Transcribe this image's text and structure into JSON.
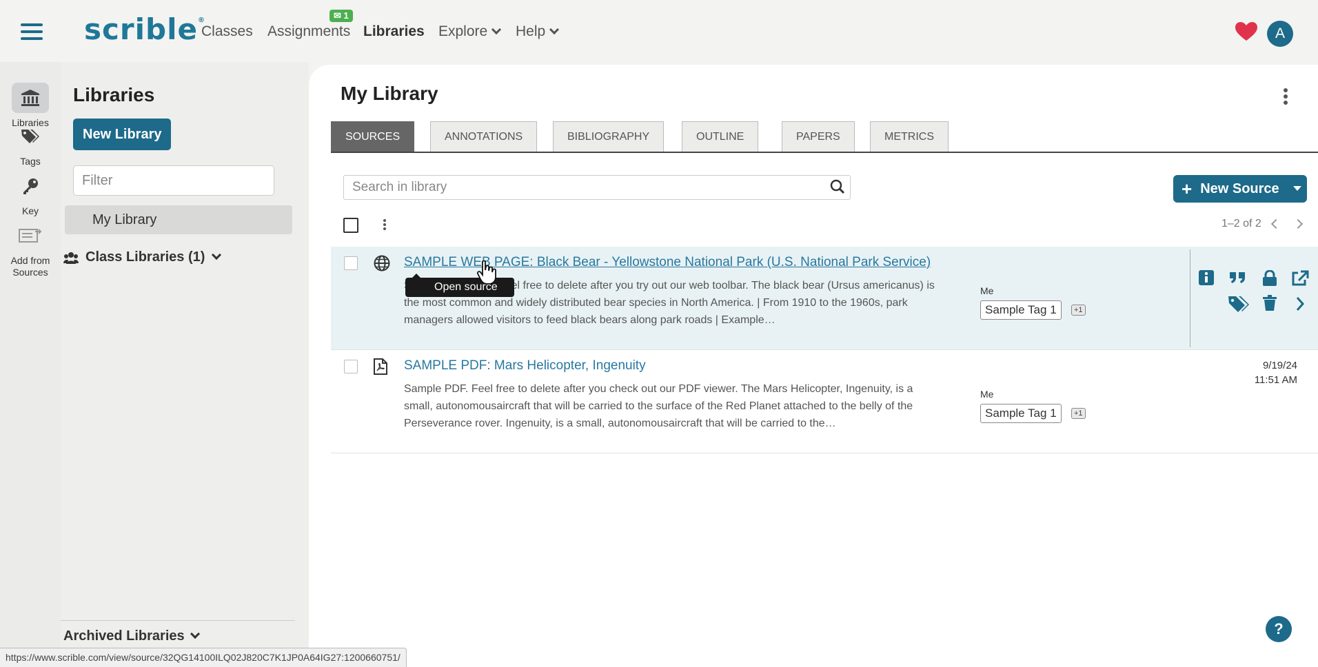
{
  "topnav": {
    "logo": "scrible",
    "logo_mark": "®",
    "links": [
      "Classes",
      "Assignments",
      "Libraries",
      "Explore",
      "Help"
    ],
    "assignments_badge": "1",
    "avatar_letter": "A"
  },
  "rail": {
    "items": [
      {
        "label": "Libraries",
        "icon": "bank-icon"
      },
      {
        "label": "Tags",
        "icon": "tags-icon"
      },
      {
        "label": "Key",
        "icon": "key-icon"
      },
      {
        "label": "Add from Sources",
        "icon": "add-sources-icon"
      }
    ]
  },
  "libraries": {
    "title": "Libraries",
    "new_library_label": "New Library",
    "filter_placeholder": "Filter",
    "my_library": "My Library",
    "class_libraries": "Class Libraries (1)",
    "archived": "Archived Libraries"
  },
  "main": {
    "title": "My Library",
    "tabs": [
      "SOURCES",
      "ANNOTATIONS",
      "BIBLIOGRAPHY",
      "OUTLINE",
      "PAPERS",
      "METRICS"
    ],
    "active_tab": "SOURCES",
    "search_placeholder": "Search in library",
    "new_source_label": "New Source",
    "pager": "1–2 of 2"
  },
  "sources": [
    {
      "type": "web",
      "title": "SAMPLE WEB PAGE: Black Bear - Yellowstone National Park (U.S. National Park Service)",
      "desc": "Sample web page. Feel free to delete after you try out our web toolbar. The black bear (Ursus americanus) is the most common and widely distributed bear species in North America. | From 1910 to the 1960s, park managers allowed visitors to feed black bears along park roads | Example…",
      "owner": "Me",
      "tag": "Sample Tag 1",
      "more_tags": "+1",
      "date": "",
      "time": ""
    },
    {
      "type": "pdf",
      "title": "SAMPLE PDF: Mars Helicopter, Ingenuity",
      "desc": "Sample PDF. Feel free to delete after you check out our PDF viewer. The Mars Helicopter, Ingenuity, is a small, autonomousaircraft that will be carried to the surface of the Red Planet attached to the belly of the Perseverance rover. Ingenuity, is a small, autonomousaircraft that will be carried to the…",
      "owner": "Me",
      "tag": "Sample Tag 1",
      "more_tags": "+1",
      "date": "9/19/24",
      "time": "11:51 AM"
    }
  ],
  "tooltip": "Open source",
  "help_label": "?",
  "status_url": "https://www.scrible.com/view/source/32QG14100ILQ02J820C7K1JP0A64IG27:1200660751/",
  "colors": {
    "accent": "#1d6a8a",
    "link": "#2878a0",
    "heart": "#e0334b",
    "badge": "#4caf50"
  }
}
